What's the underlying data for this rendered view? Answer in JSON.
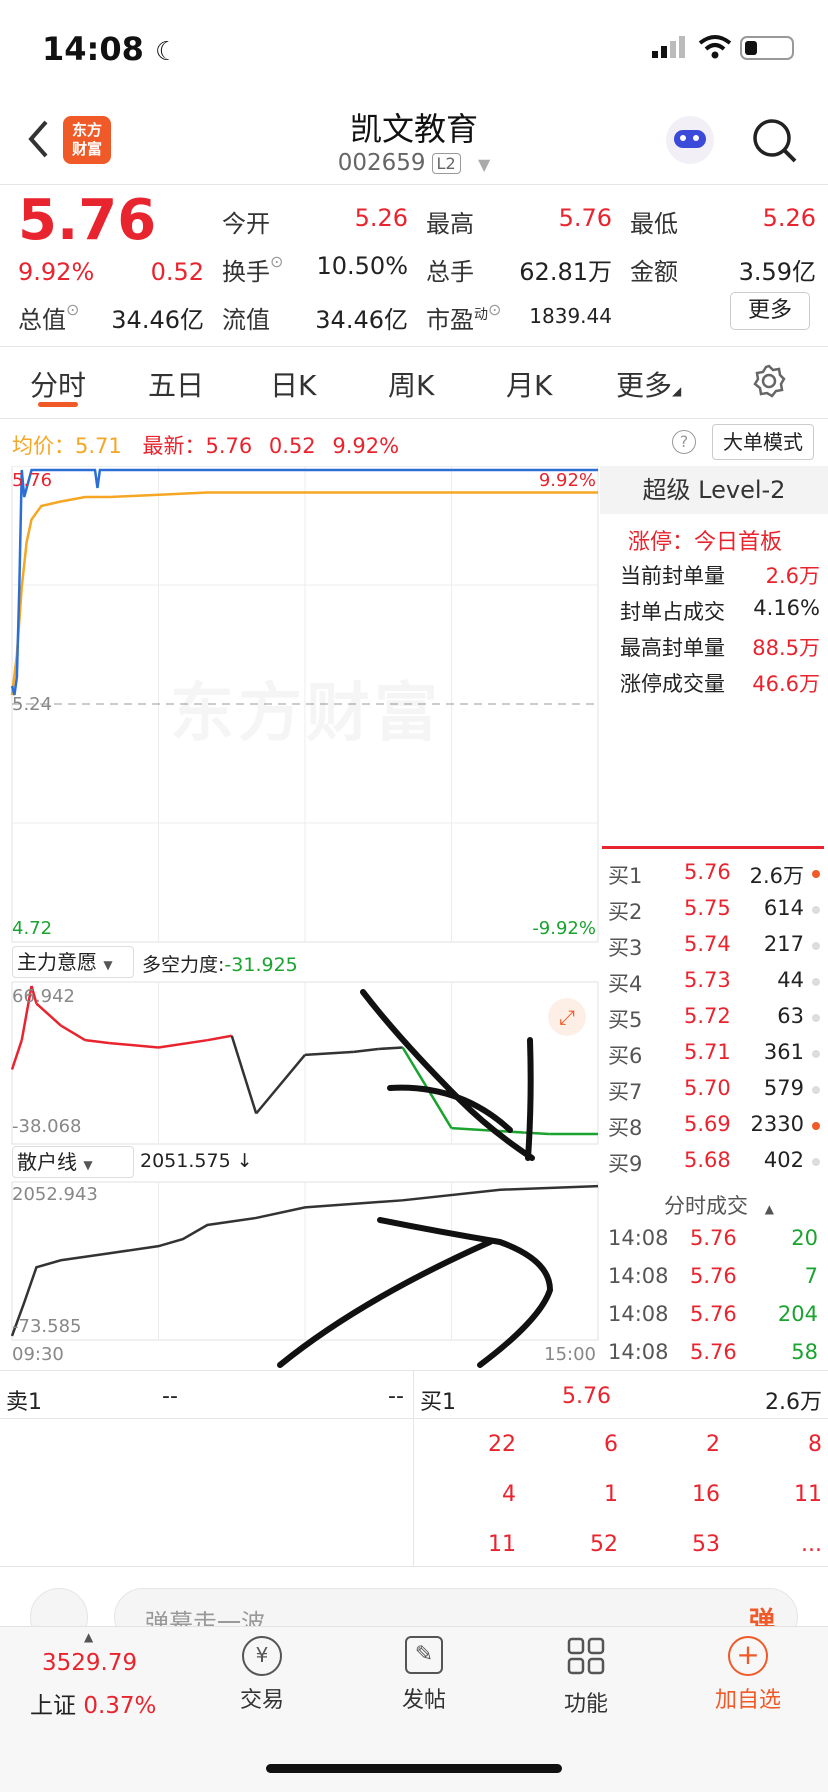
{
  "status": {
    "time": "14:08"
  },
  "header": {
    "title": "凯文教育",
    "code": "002659",
    "badge": "L2",
    "logo_line1": "东方",
    "logo_line2": "财富"
  },
  "quote": {
    "price": "5.76",
    "change_pct": "9.92%",
    "change": "0.52",
    "open_label": "今开",
    "open": "5.26",
    "high_label": "最高",
    "high": "5.76",
    "low_label": "最低",
    "low": "5.26",
    "turnover_label": "换手",
    "turnover": "10.50%",
    "volume_label": "总手",
    "volume": "62.81万",
    "amount_label": "金额",
    "amount": "3.59亿",
    "mcap_label": "总值",
    "mcap": "34.46亿",
    "float_label": "流值",
    "float": "34.46亿",
    "pe_label": "市盈",
    "pe_sup": "动",
    "pe": "1839.44",
    "more": "更多"
  },
  "tabs": [
    "分时",
    "五日",
    "日K",
    "周K",
    "月K",
    "更多"
  ],
  "info_bar": {
    "avg_label": "均价：",
    "avg": "5.71",
    "latest_label": "最新：",
    "latest": "5.76",
    "chg": "0.52",
    "pct": "9.92%",
    "mode_button": "大单模式"
  },
  "chart_data": [
    {
      "type": "line",
      "title": "",
      "ylim": [
        4.72,
        5.76
      ],
      "y_labels": {
        "top": "5.76",
        "mid": "5.24",
        "bottom": "4.72",
        "top_pct": "9.92%",
        "bottom_pct": "-9.92%"
      },
      "watermark": "东方财富",
      "series": [
        {
          "color": "#2b6fd6",
          "x": [
            0,
            1,
            2,
            3,
            4,
            5,
            8,
            9,
            10,
            15,
            30,
            34,
            35,
            36,
            40,
            80,
            150,
            190,
            240
          ],
          "values": [
            5.28,
            5.26,
            5.3,
            5.5,
            5.76,
            5.7,
            5.76,
            5.76,
            5.76,
            5.76,
            5.76,
            5.76,
            5.72,
            5.76,
            5.76,
            5.76,
            5.76,
            5.76,
            5.76
          ]
        },
        {
          "color": "#f5a623",
          "x": [
            0,
            2,
            4,
            6,
            8,
            12,
            20,
            30,
            40,
            80,
            120,
            180,
            240
          ],
          "values": [
            5.26,
            5.35,
            5.5,
            5.6,
            5.65,
            5.68,
            5.69,
            5.7,
            5.7,
            5.71,
            5.71,
            5.71,
            5.71
          ]
        }
      ],
      "x_labels": [
        "09:30",
        "15:00"
      ]
    },
    {
      "type": "line",
      "title": "",
      "dropdown": "主力意愿",
      "indicator_label": "多空力度:",
      "indicator_value": "-31.925",
      "ylim": [
        -38.068,
        66.942
      ],
      "y_labels": {
        "top": "66.942",
        "bottom": "-38.068"
      },
      "series": [
        {
          "x": [
            0,
            4,
            8,
            10,
            20,
            30,
            40,
            60,
            80,
            90,
            100,
            120,
            140,
            150,
            160,
            180,
            200,
            210,
            220,
            240
          ],
          "values": [
            10,
            30,
            67,
            55,
            40,
            30,
            28,
            25,
            30,
            33,
            -20,
            20,
            22,
            24,
            25,
            -30,
            -32,
            -33,
            -34,
            -34
          ]
        }
      ]
    },
    {
      "type": "line",
      "title": "",
      "dropdown": "散户线",
      "indicator_value": "2051.575 ↓",
      "ylim": [
        -73.585,
        2052.943
      ],
      "y_labels": {
        "top": "2052.943",
        "bottom": "-73.585"
      },
      "series": [
        {
          "x": [
            0,
            5,
            10,
            20,
            40,
            60,
            70,
            80,
            100,
            120,
            160,
            200,
            240
          ],
          "values": [
            -73,
            400,
            900,
            1000,
            1100,
            1200,
            1300,
            1500,
            1600,
            1750,
            1850,
            2000,
            2051
          ]
        }
      ]
    }
  ],
  "right_panel": {
    "title": "超级 Level-2",
    "limit_label": "涨停：",
    "limit_value": "今日首板",
    "rows": [
      {
        "label": "当前封单量",
        "value": "2.6万",
        "red": true
      },
      {
        "label": "封单占成交",
        "value": "4.16%",
        "red": false
      },
      {
        "label": "最高封单量",
        "value": "88.5万",
        "red": true
      },
      {
        "label": "涨停成交量",
        "value": "46.6万",
        "red": true
      }
    ],
    "orderbook": [
      {
        "label": "买1",
        "price": "5.76",
        "vol": "2.6万",
        "dot": "#f05a28"
      },
      {
        "label": "买2",
        "price": "5.75",
        "vol": "614",
        "dot": "#ddd"
      },
      {
        "label": "买3",
        "price": "5.74",
        "vol": "217",
        "dot": "#ddd"
      },
      {
        "label": "买4",
        "price": "5.73",
        "vol": "44",
        "dot": "#ddd"
      },
      {
        "label": "买5",
        "price": "5.72",
        "vol": "63",
        "dot": "#ddd"
      },
      {
        "label": "买6",
        "price": "5.71",
        "vol": "361",
        "dot": "#ddd"
      },
      {
        "label": "买7",
        "price": "5.70",
        "vol": "579",
        "dot": "#ddd"
      },
      {
        "label": "买8",
        "price": "5.69",
        "vol": "2330",
        "dot": "#f05a28"
      },
      {
        "label": "买9",
        "price": "5.68",
        "vol": "402",
        "dot": "#ddd"
      }
    ],
    "trades_title": "分时成交",
    "trades": [
      {
        "time": "14:08",
        "price": "5.76",
        "vol": "20"
      },
      {
        "time": "14:08",
        "price": "5.76",
        "vol": "7"
      },
      {
        "time": "14:08",
        "price": "5.76",
        "vol": "204"
      },
      {
        "time": "14:08",
        "price": "5.76",
        "vol": "58"
      }
    ]
  },
  "level2": {
    "sell_label": "卖1",
    "sell_price": "--",
    "sell_vol": "--",
    "buy_label": "买1",
    "buy_price": "5.76",
    "buy_vol": "2.6万",
    "queue": [
      [
        "22",
        "6",
        "2",
        "8"
      ],
      [
        "4",
        "1",
        "16",
        "11"
      ],
      [
        "11",
        "52",
        "53",
        "..."
      ]
    ]
  },
  "danmu": {
    "placeholder": "弹幕走一波...",
    "button": "弹"
  },
  "bottom_nav": {
    "index_value": "3529.79",
    "index_name": "上证",
    "index_pct": "0.37%",
    "items": [
      {
        "label": "交易",
        "icon": "yen-exchange-icon"
      },
      {
        "label": "发帖",
        "icon": "edit-icon"
      },
      {
        "label": "功能",
        "icon": "grid-icon"
      },
      {
        "label": "加自选",
        "icon": "plus-circle-icon"
      }
    ]
  },
  "colors": {
    "red": "#e8242e",
    "green": "#1aa32f",
    "orange": "#f5a623",
    "blue": "#2b6fd6",
    "accent": "#f05a28"
  }
}
